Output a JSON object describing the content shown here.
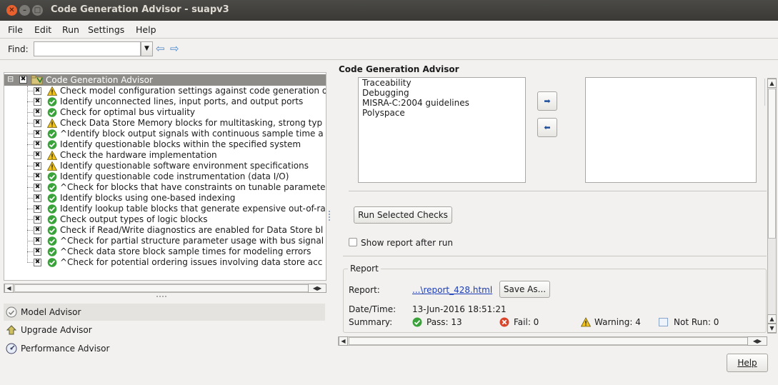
{
  "window": {
    "title": "Code Generation Advisor - suapv3",
    "close_glyph": "✕",
    "min_glyph": "–",
    "max_glyph": "□"
  },
  "menu": [
    "File",
    "Edit",
    "Run",
    "Settings",
    "Help"
  ],
  "find": {
    "label": "Find:",
    "value": "",
    "drop_glyph": "▼",
    "prev_glyph": "⇦",
    "next_glyph": "⇨"
  },
  "tree": {
    "root_label": "Code Generation Advisor",
    "root_toggle": "⊟",
    "checkbox_glyph": "✖",
    "items": [
      {
        "label": "Check model configuration settings against code generation o",
        "status": "warning"
      },
      {
        "label": "Identify unconnected lines, input ports, and output ports",
        "status": "pass"
      },
      {
        "label": "Check for optimal bus virtuality",
        "status": "pass"
      },
      {
        "label": "Check Data Store Memory blocks for multitasking, strong typ",
        "status": "warning"
      },
      {
        "label": "^Identify block output signals with continuous sample time a",
        "status": "pass"
      },
      {
        "label": "Identify questionable blocks within the specified system",
        "status": "pass"
      },
      {
        "label": "Check the hardware implementation",
        "status": "warning"
      },
      {
        "label": "Identify questionable software environment specifications",
        "status": "warning"
      },
      {
        "label": "Identify questionable code instrumentation (data I/O)",
        "status": "pass"
      },
      {
        "label": "^Check for blocks that have constraints on tunable paramete",
        "status": "pass"
      },
      {
        "label": "Identify blocks using one-based indexing",
        "status": "pass"
      },
      {
        "label": "Identify lookup table blocks that generate expensive out-of-ra",
        "status": "pass"
      },
      {
        "label": "Check output types of logic blocks",
        "status": "pass"
      },
      {
        "label": "Check if Read/Write diagnostics are enabled for Data Store bl",
        "status": "pass"
      },
      {
        "label": "^Check for partial structure parameter usage with bus signal",
        "status": "pass"
      },
      {
        "label": "^Check data store block sample times for modeling errors",
        "status": "pass"
      },
      {
        "label": "^Check for potential ordering issues involving data store acc",
        "status": "pass"
      }
    ]
  },
  "advisors": [
    "Model Advisor",
    "Upgrade Advisor",
    "Performance Advisor"
  ],
  "right": {
    "title": "Code Generation Advisor",
    "objectives": [
      "Traceability",
      "Debugging",
      "MISRA-C:2004 guidelines",
      "Polyspace"
    ],
    "add_glyph": "➡",
    "remove_glyph": "⬅",
    "run_button": "Run Selected Checks",
    "show_report_label": "Show report after run",
    "report_group": "Report",
    "report_label": "Report:",
    "report_link": "...\\report_428.html",
    "save_as": "Save As...",
    "datetime_label": "Date/Time:",
    "datetime_value": "13-Jun-2016 18:51:21",
    "summary_label": "Summary:",
    "pass": "Pass: 13",
    "fail": "Fail: 0",
    "warning": "Warning: 4",
    "not_run": "Not Run: 0"
  },
  "help_button": "Help",
  "colors": {
    "pass": "#3aa23a",
    "fail": "#d9452a",
    "warning": "#f1c21b",
    "title_bg": "#3c3b37",
    "link": "#1c3fb8"
  }
}
